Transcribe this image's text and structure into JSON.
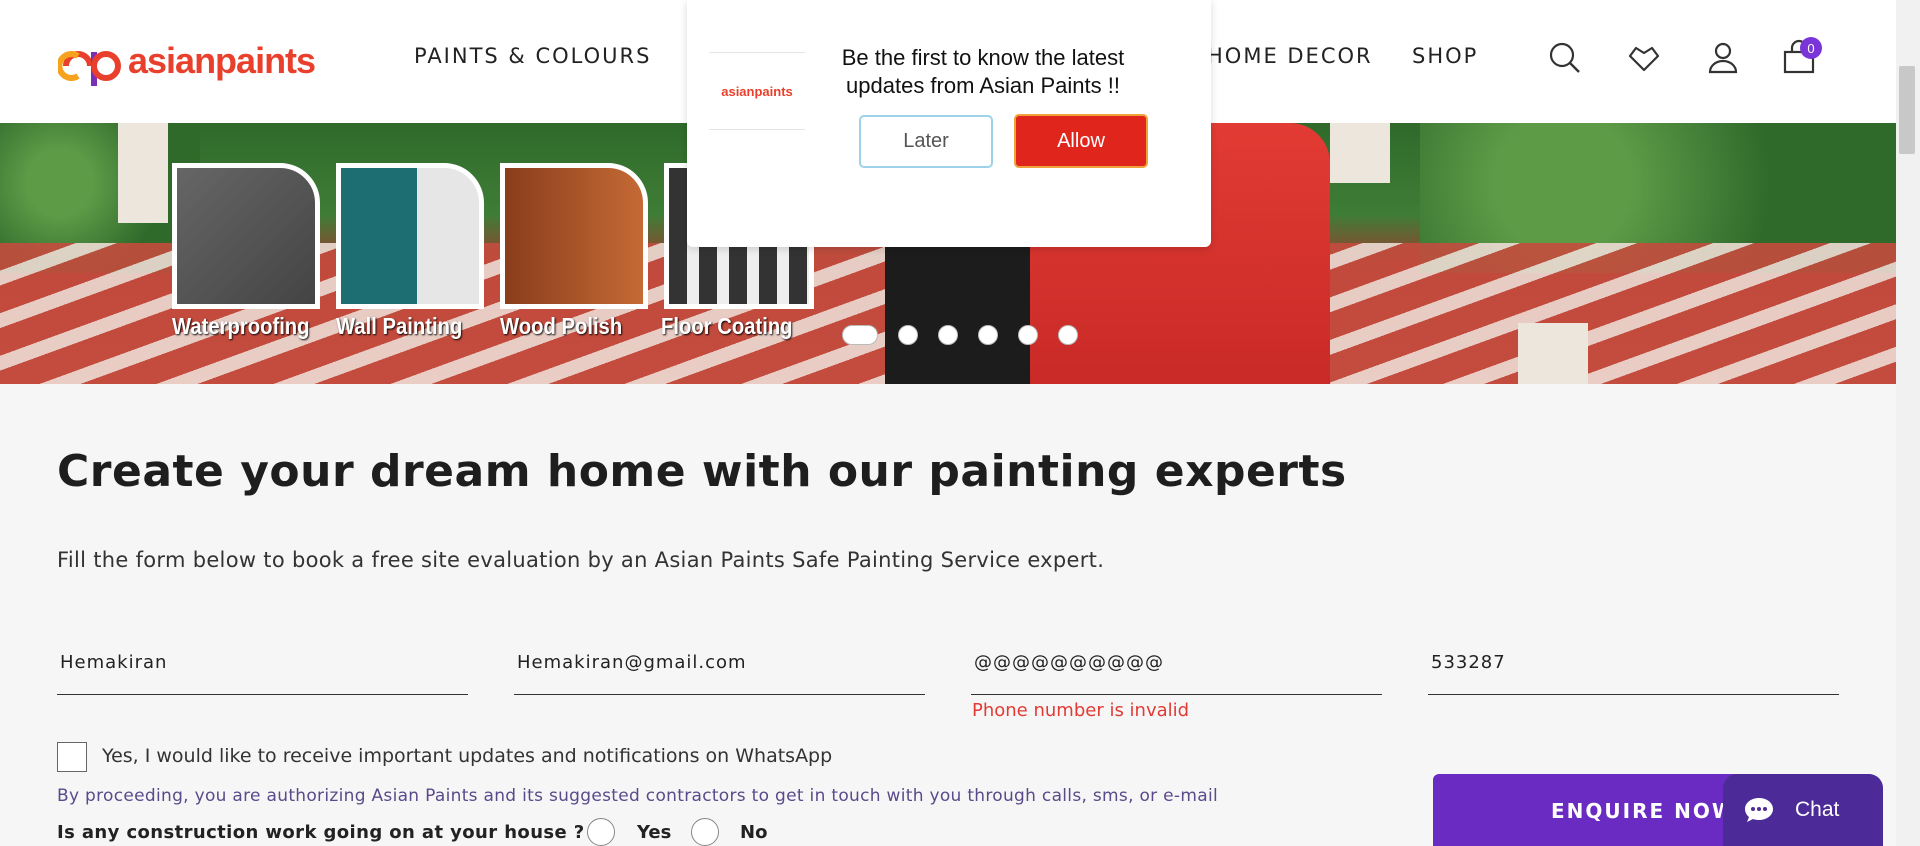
{
  "header": {
    "brand": "asianpaints",
    "nav": {
      "paints": "PAINTS & COLOURS",
      "decor": "HOME DECOR",
      "shop": "SHOP"
    },
    "icons": [
      "search-icon",
      "wishlist-icon",
      "user-icon",
      "cart-icon"
    ],
    "cart_count": "0"
  },
  "banner": {
    "services": [
      "Waterproofing",
      "Wall Painting",
      "Wood Polish",
      "Floor Coating"
    ],
    "slides": 6,
    "active_slide": 1
  },
  "popup": {
    "brand": "asianpaints",
    "message": "Be the first to know the latest updates from Asian Paints !!",
    "later_label": "Later",
    "allow_label": "Allow"
  },
  "main": {
    "title": "Create your dream home with our painting experts",
    "subtitle": "Fill the form below to book a free site evaluation by an Asian Paints Safe Painting Service expert.",
    "fields": {
      "name": "Hemakiran",
      "email": "Hemakiran@gmail.com",
      "phone": "@@@@@@@@@@",
      "pincode": "533287"
    },
    "phone_error": "Phone number is invalid",
    "whatsapp_label": "Yes, I would like to receive important updates and notifications on WhatsApp",
    "consent": "By proceeding, you are authorizing Asian Paints and its suggested contractors to get in touch with you through calls, sms, or e-mail",
    "question": "Is any construction work going on at your house ?",
    "yes_label": "Yes",
    "no_label": "No"
  },
  "enquire": {
    "label": "ENQUIRE NOW"
  },
  "chat": {
    "label": "Chat"
  },
  "colors": {
    "brand_red": "#e8402c",
    "allow_red": "#e0261c",
    "purple": "#6a2bc2",
    "error_red": "#e23b34"
  }
}
